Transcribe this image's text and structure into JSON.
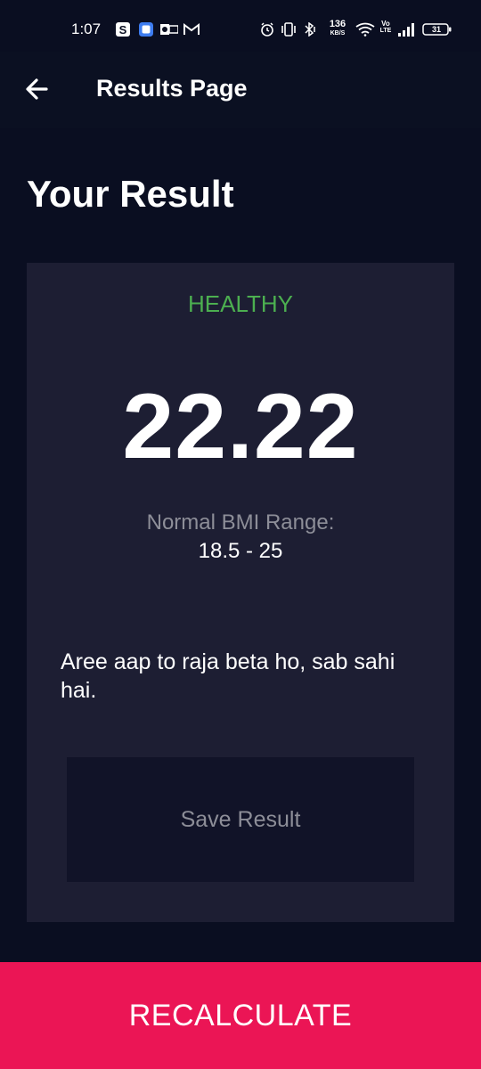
{
  "status_bar": {
    "time": "1:07",
    "network_speed_value": "136",
    "network_speed_unit": "KB/S",
    "volte_top": "Vo",
    "volte_bottom": "LTE",
    "battery_level": "31",
    "left_icons": [
      "s-app-icon",
      "blue-app-icon",
      "outlook-icon",
      "gmail-icon"
    ],
    "right_icons": [
      "alarm-icon",
      "vibrate-icon",
      "bluetooth-icon",
      "wifi-icon",
      "signal-icon",
      "battery-icon"
    ]
  },
  "app_bar": {
    "title": "Results Page",
    "back_icon": "arrow-left-icon"
  },
  "page": {
    "heading": "Your Result"
  },
  "result": {
    "status": "HEALTHY",
    "bmi": "22.22",
    "range_label": "Normal BMI Range:",
    "range_value": "18.5 - 25",
    "message": "Aree aap to raja beta ho, sab sahi hai.",
    "save_label": "Save Result"
  },
  "footer": {
    "recalculate_label": "RECALCULATE"
  },
  "colors": {
    "background": "#0a0e21",
    "card": "#1d1e33",
    "save_button": "#111328",
    "healthy": "#4caf50",
    "accent": "#eb1555",
    "muted_text": "#8d8e98"
  }
}
